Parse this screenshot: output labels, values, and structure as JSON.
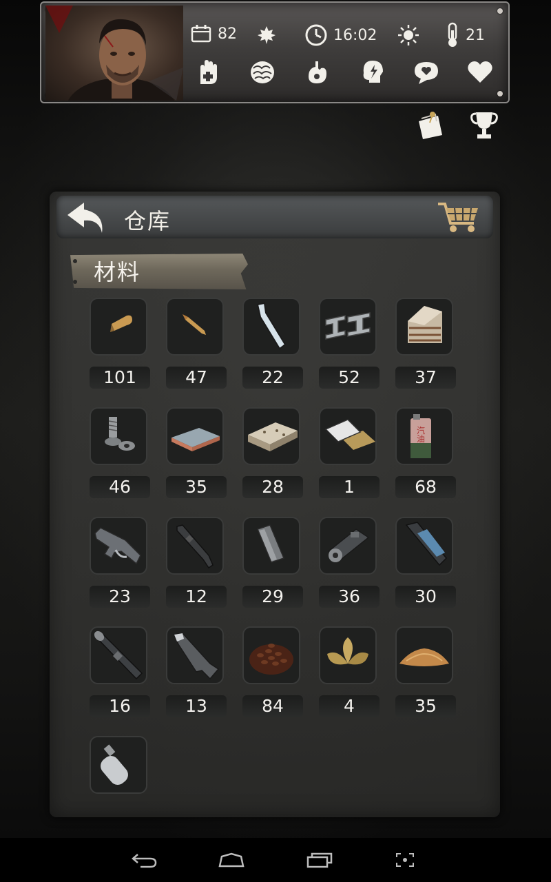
{
  "hud": {
    "stats": {
      "days": "82",
      "time": "16:02",
      "temperature": "21"
    }
  },
  "panel": {
    "title": "仓库",
    "section_label": "材料"
  },
  "items": [
    {
      "icon": "pistol-bullet-icon",
      "count": "101"
    },
    {
      "icon": "rifle-bullet-icon",
      "count": "47"
    },
    {
      "icon": "glass-bottle-icon",
      "count": "22"
    },
    {
      "icon": "steel-beam-icon",
      "count": "52"
    },
    {
      "icon": "wood-block-icon",
      "count": "37"
    },
    {
      "icon": "bolt-nut-icon",
      "count": "46"
    },
    {
      "icon": "metal-sheet-icon",
      "count": "35"
    },
    {
      "icon": "wooden-board-icon",
      "count": "28"
    },
    {
      "icon": "circuit-chip-icon",
      "count": "1"
    },
    {
      "icon": "gasoline-can-icon",
      "count": "68"
    },
    {
      "icon": "rifle-receiver-icon",
      "count": "23"
    },
    {
      "icon": "gun-barrel-icon",
      "count": "12"
    },
    {
      "icon": "magazine-icon",
      "count": "29"
    },
    {
      "icon": "gun-bolt-icon",
      "count": "36"
    },
    {
      "icon": "gun-slide-icon",
      "count": "30"
    },
    {
      "icon": "scope-icon",
      "count": "16"
    },
    {
      "icon": "gun-stock-icon",
      "count": "13"
    },
    {
      "icon": "coffee-beans-icon",
      "count": "84"
    },
    {
      "icon": "tobacco-leaves-icon",
      "count": "4"
    },
    {
      "icon": "powder-pile-icon",
      "count": "35"
    },
    {
      "icon": "gas-canister-icon",
      "count": ""
    }
  ]
}
